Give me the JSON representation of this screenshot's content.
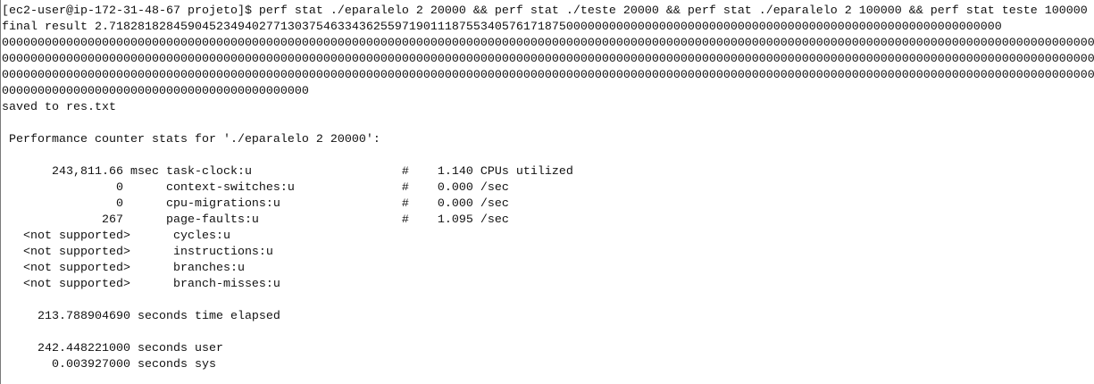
{
  "terminal": {
    "lines": [
      "[ec2-user@ip-172-31-48-67 projeto]$ perf stat ./eparalelo 2 20000 && perf stat ./teste 20000 && perf stat ./eparalelo 2 100000 && perf stat teste 100000",
      "final result 2.71828182845904523494027713037546334362559719011187553405761718750000000000000000000000000000000000000000000000000000000000000",
      "0000000000000000000000000000000000000000000000000000000000000000000000000000000000000000000000000000000000000000000000000000000000000000000000000000000000",
      "0000000000000000000000000000000000000000000000000000000000000000000000000000000000000000000000000000000000000000000000000000000000000000000000000000000000",
      "0000000000000000000000000000000000000000000000000000000000000000000000000000000000000000000000000000000000000000000000000000000000000000000000000000000000",
      "0000000000000000000000000000000000000000000",
      "saved to res.txt",
      "",
      " Performance counter stats for './eparalelo 2 20000':",
      "",
      "       243,811.66 msec task-clock:u                     #    1.140 CPUs utilized",
      "                0      context-switches:u               #    0.000 /sec",
      "                0      cpu-migrations:u                 #    0.000 /sec",
      "              267      page-faults:u                    #    1.095 /sec",
      "   <not supported>      cycles:u",
      "   <not supported>      instructions:u",
      "   <not supported>      branches:u",
      "   <not supported>      branch-misses:u",
      "",
      "     213.788904690 seconds time elapsed",
      "",
      "     242.448221000 seconds user",
      "       0.003927000 seconds sys",
      "",
      ""
    ]
  }
}
